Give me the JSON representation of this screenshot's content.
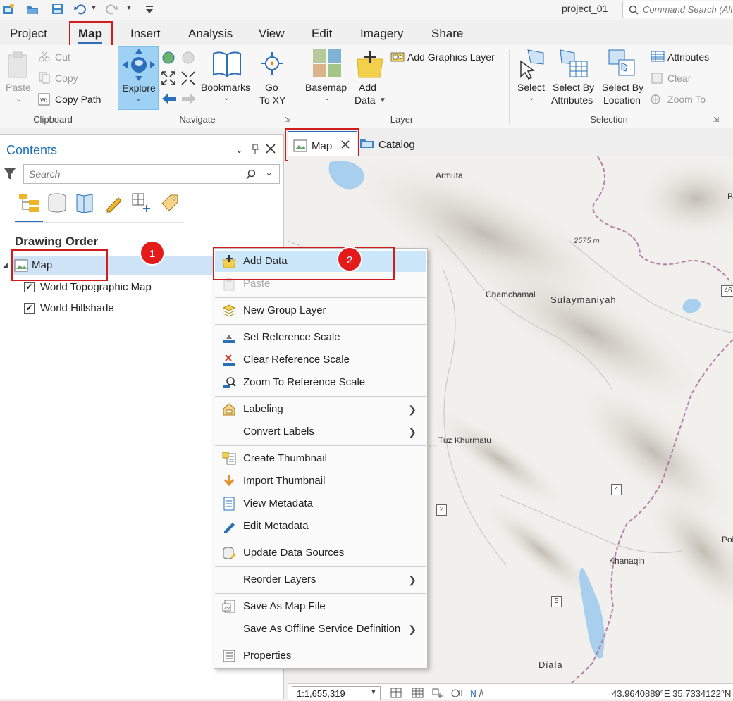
{
  "titlebar": {
    "project_name": "project_01",
    "command_search_placeholder": "Command Search (Alt+Q)",
    "quick_access_icons": [
      "new-project-icon",
      "open-project-icon",
      "save-project-icon",
      "undo-icon",
      "redo-icon",
      "customize-icon"
    ]
  },
  "ribbon_tabs": [
    "Project",
    "Map",
    "Insert",
    "Analysis",
    "View",
    "Edit",
    "Imagery",
    "Share"
  ],
  "active_tab": "Map",
  "ribbon": {
    "clipboard": {
      "label": "Clipboard",
      "paste": "Paste",
      "cut": "Cut",
      "copy": "Copy",
      "copy_path": "Copy Path"
    },
    "navigate": {
      "label": "Navigate",
      "explore": "Explore",
      "bookmarks": "Bookmarks",
      "go": "Go",
      "to_xy": "To XY"
    },
    "layer": {
      "label": "Layer",
      "basemap": "Basemap",
      "add": "Add",
      "data": "Data",
      "add_graphics_layer": "Add Graphics Layer"
    },
    "selection": {
      "label": "Selection",
      "select": "Select",
      "select_by": "Select By",
      "attributes": "Attributes",
      "location": "Location",
      "attributes_btn": "Attributes",
      "clear": "Clear",
      "zoom_to": "Zoom To"
    }
  },
  "contents": {
    "title": "Contents",
    "search_placeholder": "Search",
    "drawing_order": "Drawing Order",
    "map_item": "Map",
    "layers": [
      {
        "name": "World Topographic Map",
        "checked": true
      },
      {
        "name": "World Hillshade",
        "checked": true
      }
    ]
  },
  "view_tabs": [
    {
      "label": "Map",
      "closable": true
    },
    {
      "label": "Catalog",
      "closable": false
    }
  ],
  "map": {
    "places": [
      "Armuta",
      "Chamchamal",
      "Sulaymaniyah",
      "Tuz Khurmatu",
      "Khanaqin",
      "Diala",
      "B",
      "Pol"
    ],
    "elevation_label": "2575 m",
    "highways": [
      "46",
      "4",
      "2",
      "5"
    ]
  },
  "status": {
    "scale": "1:1,655,319",
    "coordinates": "43.9640889°E 35.7334122°N"
  },
  "context_menu": [
    {
      "label": "Add Data",
      "icon": "add-data-icon",
      "highlighted": true
    },
    {
      "label": "Paste",
      "icon": "paste-icon",
      "disabled": true
    },
    {
      "label": "New Group Layer",
      "icon": "group-layer-icon"
    },
    {
      "label": "Set Reference Scale",
      "icon": "set-scale-icon"
    },
    {
      "label": "Clear Reference Scale",
      "icon": "clear-scale-icon"
    },
    {
      "label": "Zoom To Reference Scale",
      "icon": "zoom-scale-icon"
    },
    {
      "label": "Labeling",
      "icon": "labeling-icon",
      "submenu": true
    },
    {
      "label": "Convert Labels",
      "icon": "",
      "submenu": true
    },
    {
      "label": "Create Thumbnail",
      "icon": "thumbnail-icon"
    },
    {
      "label": "Import Thumbnail",
      "icon": "import-arrow-icon"
    },
    {
      "label": "View Metadata",
      "icon": "metadata-icon"
    },
    {
      "label": "Edit Metadata",
      "icon": "pencil-icon"
    },
    {
      "label": "Update Data Sources",
      "icon": "datasource-icon"
    },
    {
      "label": "Reorder Layers",
      "icon": "",
      "submenu": true
    },
    {
      "label": "Save As Map File",
      "icon": "map-file-icon"
    },
    {
      "label": "Save As Offline Service Definition",
      "icon": "",
      "submenu": true
    },
    {
      "label": "Properties",
      "icon": "properties-icon"
    }
  ],
  "annotations": {
    "step1": "1",
    "step2": "2"
  },
  "colors": {
    "accent": "#1d6fb8",
    "highlight": "#cce6fa",
    "annotation_red": "#d11c1c",
    "map_bg": "#f2f0ec"
  }
}
